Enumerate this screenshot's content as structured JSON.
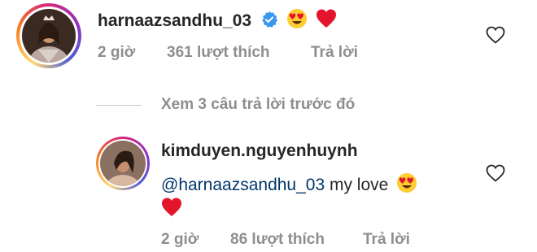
{
  "comments": [
    {
      "username": "harnaazsandhu_03",
      "verified": true,
      "text_emojis": [
        "smiling-face-heart-eyes",
        "red-heart"
      ],
      "meta": {
        "time": "2 giờ",
        "likes": "361 lượt thích",
        "reply": "Trả lời"
      }
    },
    {
      "username": "kimduyen.nguyenhuynh",
      "verified": false,
      "mention": "@harnaazsandhu_03",
      "text": " my love",
      "text_emojis": [
        "smiling-face-heart-eyes",
        "red-heart"
      ],
      "meta": {
        "time": "2 giờ",
        "likes": "86 lượt thích",
        "reply": "Trả lời"
      }
    }
  ],
  "view_previous": "Xem 3 câu trả lời trước đó",
  "colors": {
    "text": "#262626",
    "meta": "#8e8e8e",
    "mention": "#00376b",
    "verified": "#3897f0",
    "heart": "#e3152c"
  }
}
